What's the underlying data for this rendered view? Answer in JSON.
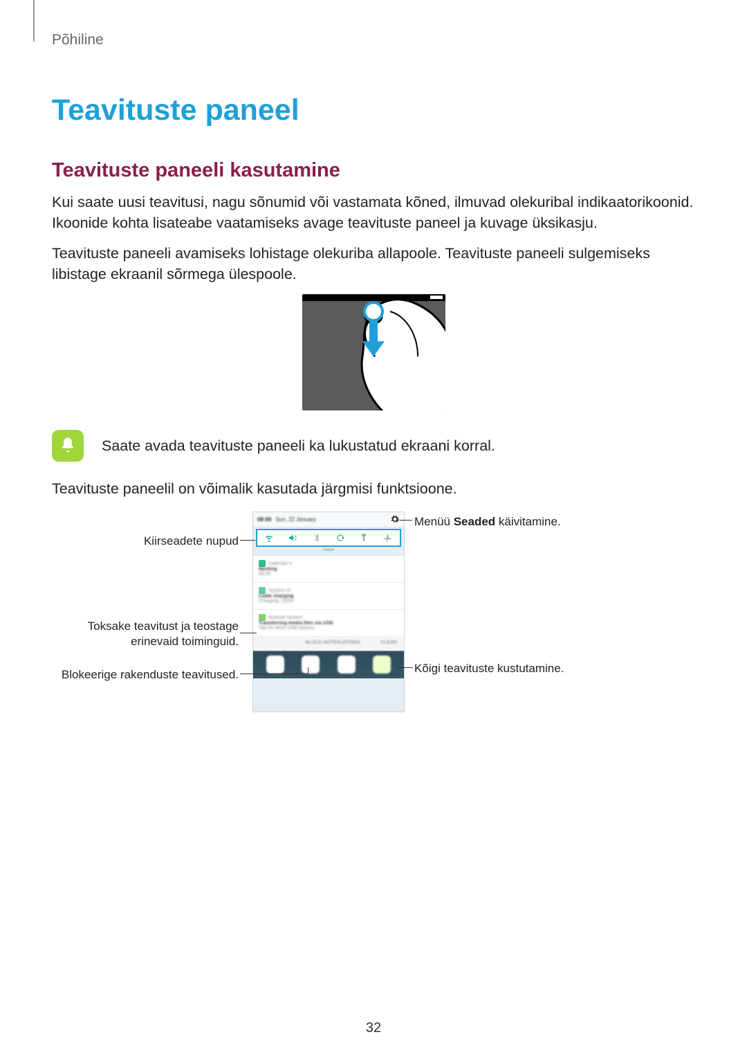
{
  "breadcrumb": "Põhiline",
  "h1": "Teavituste paneel",
  "h2": "Teavituste paneeli kasutamine",
  "para1": "Kui saate uusi teavitusi, nagu sõnumid või vastamata kõned, ilmuvad olekuribal indikaatorikoonid. Ikoonide kohta lisateabe vaatamiseks avage teavituste paneel ja kuvage üksikasju.",
  "para2": "Teavituste paneeli avamiseks lohistage olekuriba allapoole. Teavituste paneeli sulgemiseks libistage ekraanil sõrmega ülespoole.",
  "note": "Saate avada teavituste paneeli ka lukustatud ekraani korral.",
  "para3": "Teavituste paneelil on võimalik kasutada järgmisi funktsioone.",
  "callouts": {
    "left1": "Kiirseadete nupud",
    "left2a": "Toksake teavitust ja teostage",
    "left2b": "erinevaid toiminguid.",
    "left3": "Blokeerige rakenduste teavitused.",
    "right1_pre": "Menüü ",
    "right1_bold": "Seaded",
    "right1_post": " käivitamine.",
    "right2": "Kõigi teavituste kustutamine."
  },
  "phone": {
    "status_time": "08:00",
    "status_date": "Sun, 22 January",
    "qs_label": "Swipe",
    "notif1_app": "Calendar",
    "notif1_title": "Meeting",
    "notif1_sub": "08:00",
    "notif2_app": "System UI",
    "notif2_title": "Cable charging",
    "notif2_sub": "Charging: 100%",
    "notif3_app": "Android System",
    "notif3_title": "Transferring media files via USB",
    "notif3_sub": "Tap for other USB options.",
    "action_block": "BLOCK NOTIFICATIONS",
    "action_clear": "CLEAR"
  },
  "page_number": "32"
}
